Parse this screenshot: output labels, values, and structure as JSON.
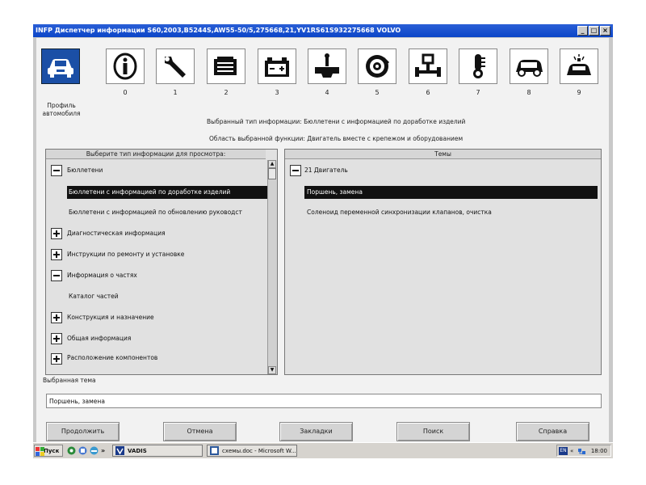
{
  "window": {
    "title": "INFP Диспетчер информации S60,2003,B5244S,AW55-50/5,275668,21,YV1RS61S932275668 VOLVO",
    "btn_min": "_",
    "btn_max": "□",
    "btn_close": "×"
  },
  "toolbar": {
    "profile_label": "Профиль автомобиля",
    "numbers": [
      "0",
      "1",
      "2",
      "3",
      "4",
      "5",
      "6",
      "7",
      "8",
      "9"
    ]
  },
  "info": {
    "selected_type_line": "Выбранный тип информации: Бюллетени с информацией по доработке изделий",
    "selected_area_line": "Область выбранной функции: Двигатель вместе с крепежом и оборудованием"
  },
  "left_panel": {
    "header": "Выберите тип информации для просмотра:",
    "items": [
      {
        "label": "Бюллетени"
      },
      {
        "label": "Бюллетени с информацией по доработке изделий"
      },
      {
        "label": "Бюллетени с информацией по обновлению руководст"
      },
      {
        "label": "Диагностическая информация"
      },
      {
        "label": "Инструкции по ремонту и установке"
      },
      {
        "label": "Информация о частях"
      },
      {
        "label": "Каталог частей"
      },
      {
        "label": "Конструкция и назначение"
      },
      {
        "label": "Общая информация"
      },
      {
        "label": "Расположение компонентов"
      }
    ]
  },
  "right_panel": {
    "header": "Темы",
    "items": [
      {
        "label": "21 Двигатель"
      },
      {
        "label": "Поршень, замена"
      },
      {
        "label": "Соленоид переменной синхронизации клапанов, очистка"
      }
    ]
  },
  "selected_topic": {
    "label": "Выбранная тема",
    "value": "Поршень, замена"
  },
  "buttons": {
    "continue": "Продолжить",
    "cancel": "Отмена",
    "bookmarks": "Закладки",
    "search": "Поиск",
    "help": "Справка"
  },
  "taskbar": {
    "start": "Пуск",
    "arrows": "»",
    "vadis": "VADIS",
    "doc": "схемы.doc - Microsoft W...",
    "tray_lang": "EN",
    "tray_arrows": "«",
    "clock": "18:00"
  },
  "colors": {
    "titlebar": "#0b45c8",
    "selection": "#111111",
    "selected_icon_bg": "#1b4fa6"
  }
}
